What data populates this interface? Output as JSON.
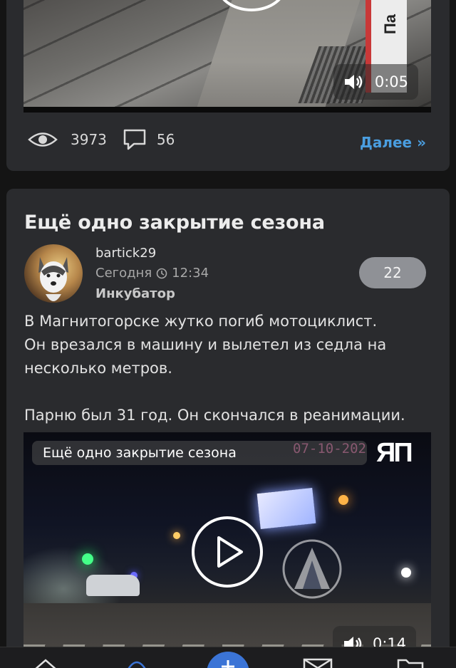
{
  "previous_post": {
    "sign_text": "Па",
    "video_duration": "0:05",
    "views": "3973",
    "comments": "56",
    "more_link": "Далее »"
  },
  "post": {
    "title": "Ещё одно закрытие сезона",
    "author": "bartick29",
    "date_prefix": "Сегодня",
    "time": "12:34",
    "community": "Инкубатор",
    "rating": "22",
    "text_lines": [
      "В Магнитогорске жутко погиб мотоциклист.",
      "Он врезался в машину и вылетел из седла на",
      "несколько метров.",
      "Парню был 31 год. Он скончался в реанимации."
    ],
    "video": {
      "caption": "Ещё одно закрытие сезона",
      "overlay_date": "07-10-202",
      "logo": "ЯП",
      "duration": "0:14"
    }
  },
  "icons": {
    "views": "eye-icon",
    "comments": "comment-icon",
    "clock": "clock-icon",
    "volume": "volume-icon",
    "play": "play-icon"
  },
  "colors": {
    "background": "#141414",
    "card": "#2a2b2e",
    "link": "#4a9ee0",
    "rating_badge": "#8f9196",
    "nav_accent": "#3b74d6"
  }
}
